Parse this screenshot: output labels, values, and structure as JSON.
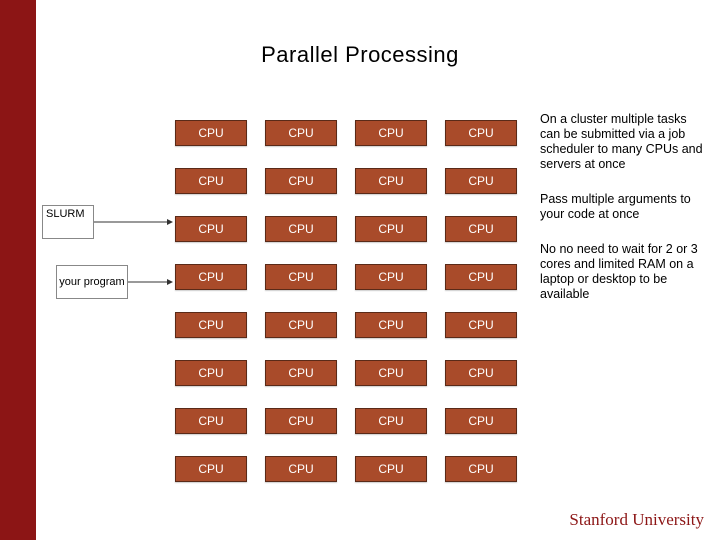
{
  "title": "Parallel Processing",
  "cpu_label": "CPU",
  "grid_rows": 8,
  "grid_cols": 4,
  "slurm_label": "SLURM",
  "your_program_label": "your program",
  "notes": [
    "On a cluster multiple tasks can be submitted via a job scheduler to many CPUs and servers at once",
    "Pass multiple arguments to your code at once",
    "No no need to wait for 2 or 3 cores and limited RAM on a laptop or desktop to be available"
  ],
  "brand": "Stanford University",
  "colors": {
    "accent": "#8c1515",
    "cpu_fill": "#a94b2a"
  }
}
